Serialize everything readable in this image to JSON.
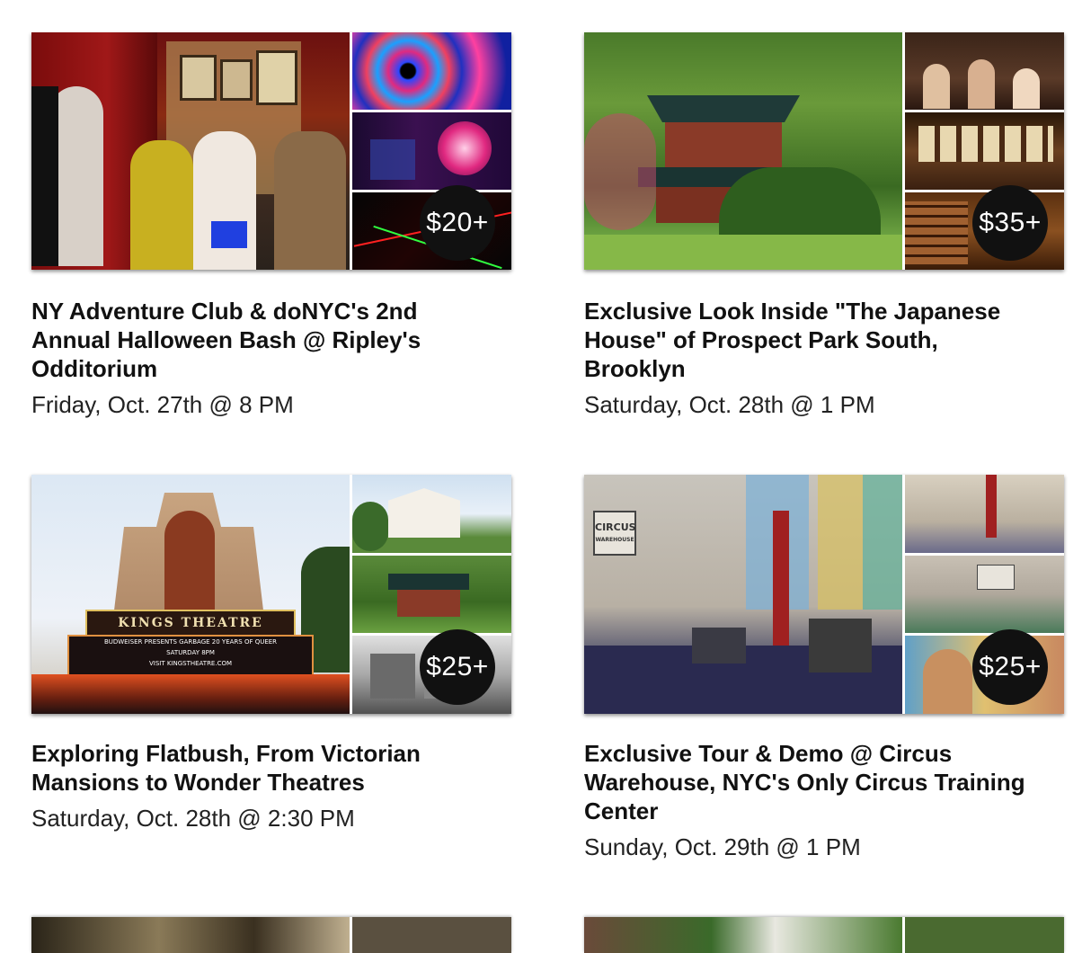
{
  "events": [
    {
      "title": "NY Adventure Club & doNYC's 2nd Annual Halloween Bash @ Ripley's Odditorium",
      "date": "Friday, Oct. 27th @ 8 PM",
      "price": "$20+"
    },
    {
      "title": "Exclusive Look Inside \"The Japanese House\" of Prospect Park South, Brooklyn",
      "date": "Saturday, Oct. 28th @ 1 PM",
      "price": "$35+"
    },
    {
      "title": "Exploring Flatbush, From Victorian Mansions to Wonder Theatres",
      "date": "Saturday, Oct. 28th @ 2:30 PM",
      "price": "$25+"
    },
    {
      "title": "Exclusive Tour & Demo @ Circus Warehouse, NYC's Only Circus Training Center",
      "date": "Sunday, Oct. 29th @ 1 PM",
      "price": "$25+"
    }
  ],
  "photo_text": {
    "kings_theatre": "KINGS THEATRE",
    "marquee_line1": "BUDWEISER PRESENTS GARBAGE 20 YEARS OF QUEER",
    "marquee_line2": "SATURDAY 8PM",
    "marquee_line3": "VISIT KINGSTHEATRE.COM",
    "circus_sign": "CIRCUS",
    "circus_sign_sub": "WAREHOUSE"
  }
}
